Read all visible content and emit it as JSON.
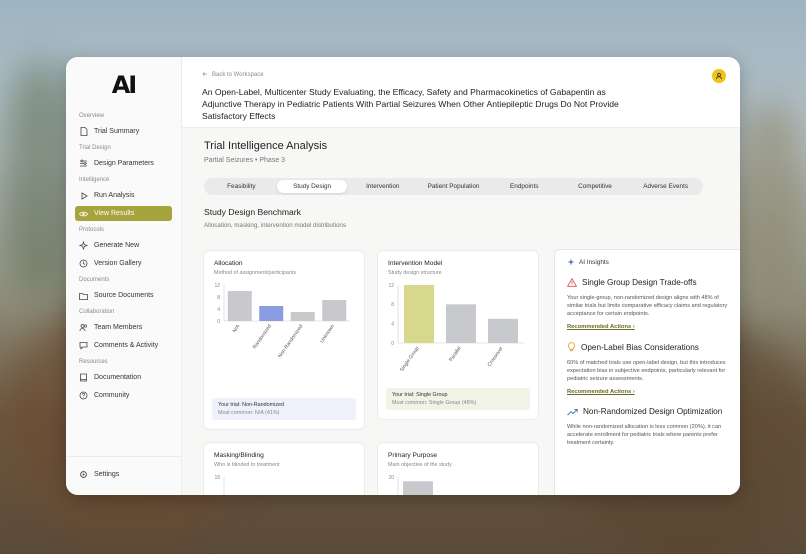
{
  "brand": {
    "logo_text": "AI"
  },
  "sidebar": {
    "sections": [
      {
        "heading": "Overview",
        "items": [
          {
            "label": "Trial Summary",
            "icon": "file-icon"
          }
        ]
      },
      {
        "heading": "Trial Design",
        "items": [
          {
            "label": "Design Parameters",
            "icon": "sliders-icon"
          }
        ]
      },
      {
        "heading": "Intelligence",
        "items": [
          {
            "label": "Run Analysis",
            "icon": "play-icon"
          },
          {
            "label": "View Results",
            "icon": "eye-icon",
            "active": true
          }
        ]
      },
      {
        "heading": "Protocols",
        "items": [
          {
            "label": "Generate New",
            "icon": "sparkle-icon"
          },
          {
            "label": "Version Gallery",
            "icon": "history-icon"
          }
        ]
      },
      {
        "heading": "Documents",
        "items": [
          {
            "label": "Source Documents",
            "icon": "folder-icon"
          }
        ]
      },
      {
        "heading": "Collaboration",
        "items": [
          {
            "label": "Team Members",
            "icon": "users-icon"
          },
          {
            "label": "Comments & Activity",
            "icon": "chat-icon"
          }
        ]
      },
      {
        "heading": "Resources",
        "items": [
          {
            "label": "Documentation",
            "icon": "book-icon"
          },
          {
            "label": "Community",
            "icon": "help-icon"
          }
        ]
      }
    ],
    "settings_label": "Settings"
  },
  "header": {
    "back_label": "Back to Workspace",
    "trial_title": "An Open-Label, Multicenter Study Evaluating, the Efficacy, Safety and Pharmacokinetics of Gabapentin as Adjunctive Therapy in Pediatric Patients With Partial Seizures When Other Antiepileptic Drugs Do Not Provide Satisfactory Effects"
  },
  "analysis": {
    "title": "Trial Intelligence Analysis",
    "subtitle": "Partial Seizures • Phase 3",
    "tabs": [
      "Feasibility",
      "Study Design",
      "Intervention",
      "Patient Population",
      "Endpoints",
      "Competitive",
      "Adverse Events"
    ],
    "active_tab": "Study Design",
    "section_title": "Study Design Benchmark",
    "section_subtitle": "Allocation, masking, intervention model distributions"
  },
  "cards": {
    "allocation": {
      "title": "Allocation",
      "subtitle": "Method of assignment/participants",
      "your_trial_label": "Your trial:",
      "your_trial_value": "Non-Randomized",
      "most_common_label": "Most common:",
      "most_common_value": "N/A (41%)"
    },
    "intervention": {
      "title": "Intervention Model",
      "subtitle": "Study design structure",
      "your_trial_label": "Your trial:",
      "your_trial_value": "Single Group",
      "most_common_label": "Most common:",
      "most_common_value": "Single Group (48%)"
    },
    "masking": {
      "title": "Masking/Blinding",
      "subtitle": "Who is blinded to treatment"
    },
    "purpose": {
      "title": "Primary Purpose",
      "subtitle": "Main objective of the study"
    }
  },
  "chart_data": [
    {
      "type": "bar",
      "categories": [
        "N/A",
        "Randomized",
        "Non-Randomized",
        "Unknown"
      ],
      "values": [
        10,
        5,
        3,
        7
      ],
      "ylim": [
        0,
        12
      ],
      "yticks": [
        0,
        4,
        8,
        12
      ],
      "highlight": "Randomized",
      "colors": {
        "default": "#c8c9cd",
        "highlight": "#8b9de0"
      }
    },
    {
      "type": "bar",
      "categories": [
        "Single Group",
        "Parallel",
        "Crossover"
      ],
      "values": [
        12,
        8,
        5
      ],
      "ylim": [
        0,
        12
      ],
      "yticks": [
        0,
        4,
        8,
        12
      ],
      "highlight": "Single Group",
      "colors": {
        "default": "#c8c9cd",
        "highlight": "#d8d88c"
      }
    },
    {
      "type": "bar",
      "categories": [],
      "values": [
        10
      ],
      "ylim": [
        0,
        18
      ],
      "yticks": [
        12,
        18
      ],
      "colors": {
        "default": "#c8c9cd",
        "highlight": "#8b9de0"
      }
    },
    {
      "type": "bar",
      "categories": [],
      "values": [
        19
      ],
      "ylim": [
        0,
        20
      ],
      "yticks": [
        20
      ],
      "colors": {
        "default": "#c8c9cd",
        "highlight": "#c8c9cd"
      }
    }
  ],
  "insights": {
    "header": "AI Insights",
    "items": [
      {
        "title": "Single Group Design Trade-offs",
        "icon": "warning-icon",
        "color": "#d9534f",
        "body": "Your single-group, non-randomized design aligns with 48% of similar trials but limits comparative efficacy claims and regulatory acceptance for certain endpoints.",
        "link": "Recommended Actions"
      },
      {
        "title": "Open-Label Bias Considerations",
        "icon": "lightbulb-icon",
        "color": "#e8a23c",
        "body": "60% of matched trials use open-label design, but this introduces expectation bias in subjective endpoints, particularly relevant for pediatric seizure assessments.",
        "link": "Recommended Actions"
      },
      {
        "title": "Non-Randomized Design Optimization",
        "icon": "trend-up-icon",
        "color": "#3f6fb5",
        "body": "While non-randomized allocation is less common (20%), it can accelerate enrollment for pediatric trials where parents prefer treatment certainty.",
        "link": ""
      }
    ]
  }
}
